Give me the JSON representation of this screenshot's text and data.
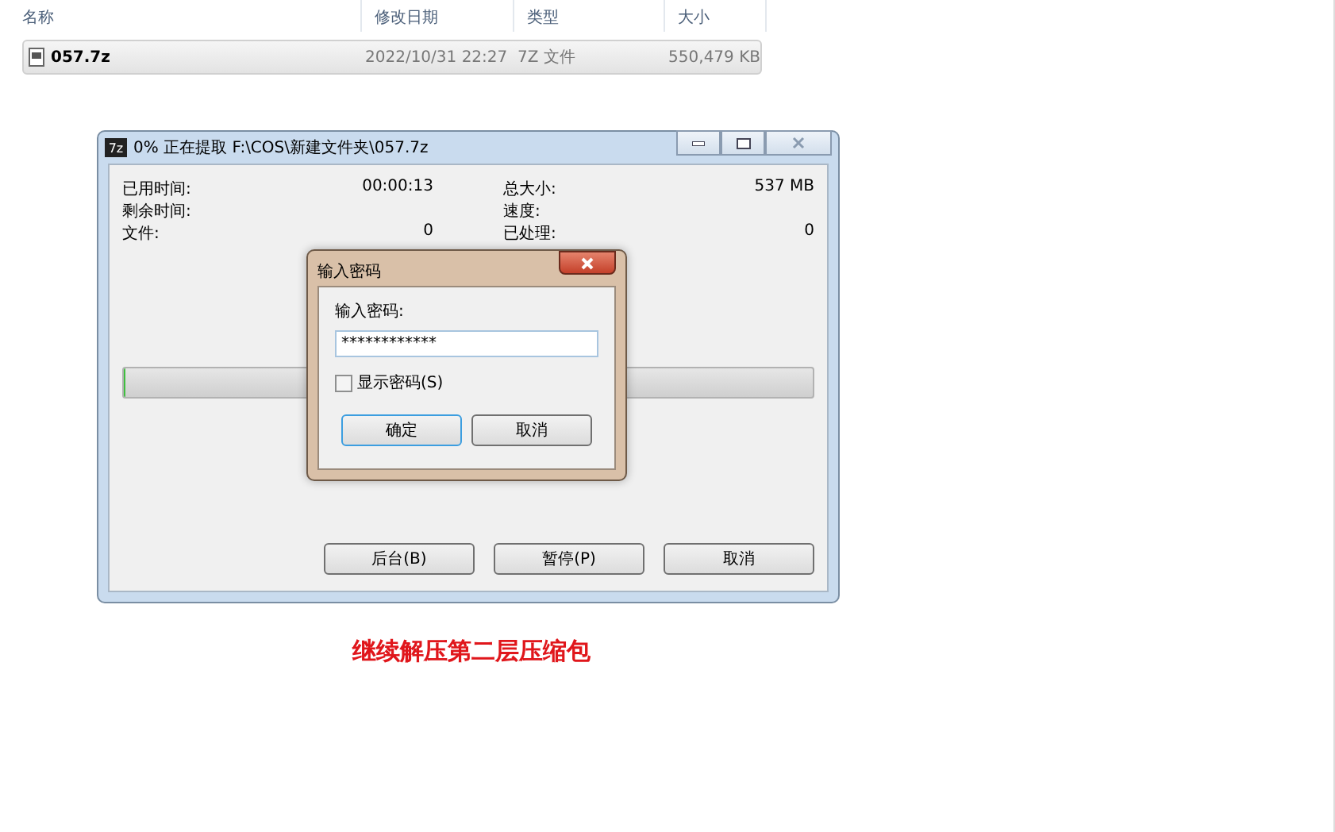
{
  "explorer": {
    "columns": [
      "名称",
      "修改日期",
      "类型",
      "大小"
    ],
    "rows": [
      {
        "name": "057.7z",
        "date": "2022/10/31 22:27",
        "type": "7Z 文件",
        "size": "550,479 KB",
        "selected": true
      }
    ]
  },
  "progress_window": {
    "title": "0% 正在提取 F:\\COS\\新建文件夹\\057.7z",
    "icon": "7z",
    "stats_left": [
      {
        "label": "已用时间:",
        "value": "00:00:13"
      },
      {
        "label": "剩余时间:"
      },
      {
        "label": "文件:",
        "value": "0"
      }
    ],
    "stats_right": [
      {
        "label": "总大小:",
        "value": "537 MB"
      },
      {
        "label": "速度:"
      },
      {
        "label": "已处理:",
        "value": "0"
      }
    ],
    "level": 0,
    "buttons": [
      "后台(B)",
      "暂停(P)",
      "取消"
    ]
  },
  "password_dialog": {
    "title": "输入密码",
    "prompt": "输入密码:",
    "value": "************",
    "show_password": {
      "label": "显示密码(S)",
      "checked": false
    },
    "buttons": [
      "确定",
      "取消"
    ]
  },
  "caption": "继续解压第二层压缩包"
}
